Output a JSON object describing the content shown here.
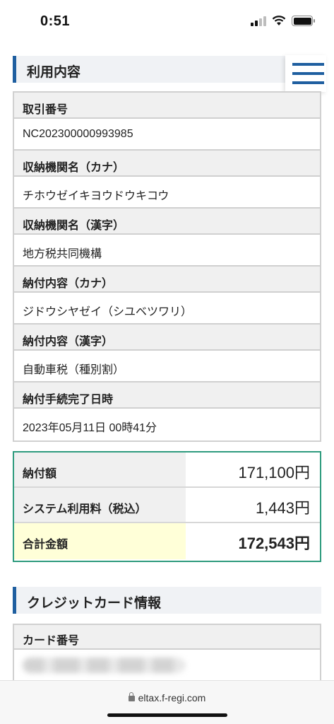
{
  "status_bar": {
    "time": "0:51"
  },
  "usage_section": {
    "title": "利用内容",
    "rows": [
      {
        "label": "取引番号",
        "value": "NC202300000993985"
      },
      {
        "label": "収納機関名（カナ）",
        "value": "チホウゼイキヨウドウキコウ"
      },
      {
        "label": "収納機関名（漢字）",
        "value": "地方税共同機構"
      },
      {
        "label": "納付内容（カナ）",
        "value": "ジドウシヤゼイ（シユベツワリ）"
      },
      {
        "label": "納付内容（漢字）",
        "value": "自動車税（種別割）"
      },
      {
        "label": "納付手続完了日時",
        "value": "2023年05月11日 00時41分"
      }
    ]
  },
  "amounts": {
    "payment": {
      "label": "納付額",
      "value": "171,100円"
    },
    "fee": {
      "label": "システム利用料（税込）",
      "value": "1,443円"
    },
    "total": {
      "label": "合計金額",
      "value": "172,543円"
    }
  },
  "card_section": {
    "title": "クレジットカード情報",
    "card_number_label": "カード番号"
  },
  "browser": {
    "url": "eltax.f-regi.com"
  },
  "colors": {
    "accent": "#1f5fa0",
    "total_border": "#2e9b7e",
    "total_highlight": "#ffffd8"
  }
}
